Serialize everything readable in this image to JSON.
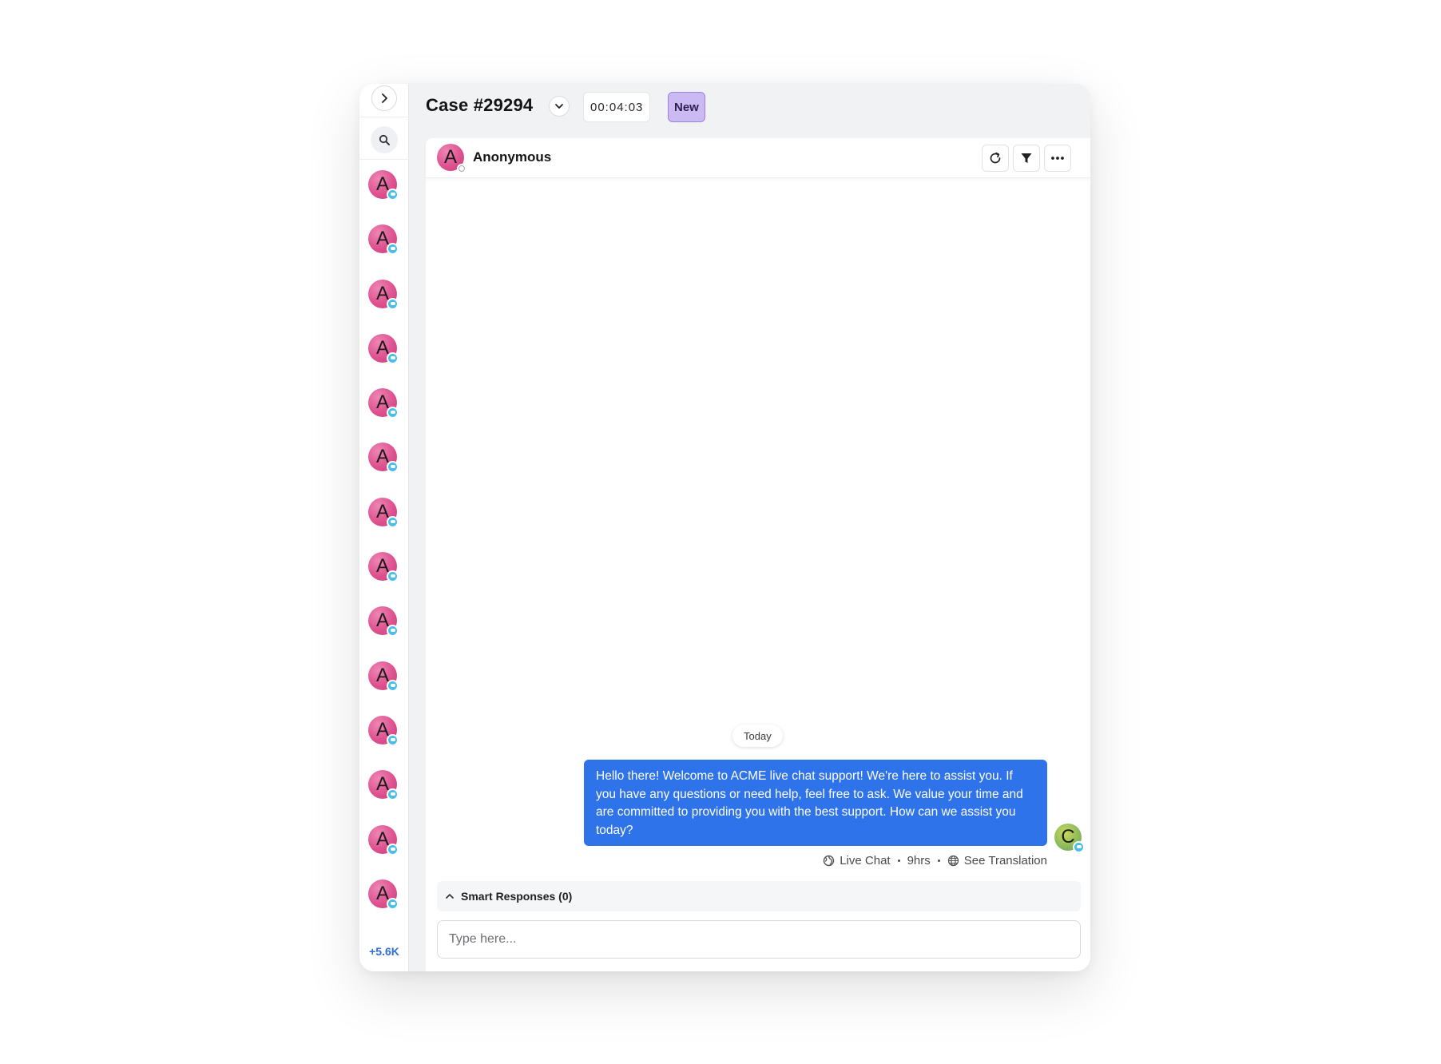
{
  "rail": {
    "avatar_initial": "A",
    "avatar_count": 14,
    "more_label": "+5.6K"
  },
  "header": {
    "case_title": "Case #29294",
    "timer": "00:04:03",
    "status": "New"
  },
  "conversation": {
    "contact_initial": "A",
    "contact_name": "Anonymous",
    "day_label": "Today",
    "message": "Hello there! Welcome to ACME live chat support! We're here to assist you. If you have any questions or need help, feel free to ask. We value your time and are committed to providing you with the best support. How can we assist you today?",
    "agent_initial": "C",
    "channel": "Live Chat",
    "age": "9hrs",
    "translation_link": "See Translation"
  },
  "smart_responses": {
    "label": "Smart Responses (0)"
  },
  "composer": {
    "placeholder": "Type here..."
  },
  "colors": {
    "accent": "#2f73ea",
    "status_bg": "#cbb9f3",
    "avatar": "#de5290",
    "chat_badge": "#49bfe8"
  },
  "icons": [
    "chevron-right-icon",
    "search-icon",
    "chat-bubble-icon",
    "chevron-down-icon",
    "refresh-icon",
    "filter-icon",
    "more-icon",
    "globe-icon",
    "translate-icon",
    "chevron-up-icon"
  ]
}
